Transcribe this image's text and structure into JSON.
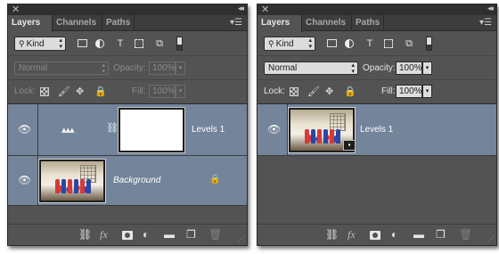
{
  "panels": [
    {
      "tabs": [
        "Layers",
        "Channels",
        "Paths"
      ],
      "kind_label": "Kind",
      "blend_mode": "Normal",
      "opacity_label": "Opacity:",
      "opacity_value": "100%",
      "lock_label": "Lock:",
      "fill_label": "Fill:",
      "fill_value": "100%",
      "layers": [
        {
          "name": "Levels 1",
          "type": "adjustment-with-mask"
        },
        {
          "name": "Background",
          "type": "background",
          "locked": true
        }
      ]
    },
    {
      "tabs": [
        "Layers",
        "Channels",
        "Paths"
      ],
      "kind_label": "Kind",
      "blend_mode": "Normal",
      "opacity_label": "Opacity:",
      "opacity_value": "100%",
      "lock_label": "Lock:",
      "fill_label": "Fill:",
      "fill_value": "100%",
      "layers": [
        {
          "name": "Levels 1",
          "type": "smart-object"
        }
      ]
    }
  ],
  "colors": {
    "panel_bg": "#535353",
    "selected_layer": "#73849b",
    "titlebar": "#2f2f2f"
  }
}
